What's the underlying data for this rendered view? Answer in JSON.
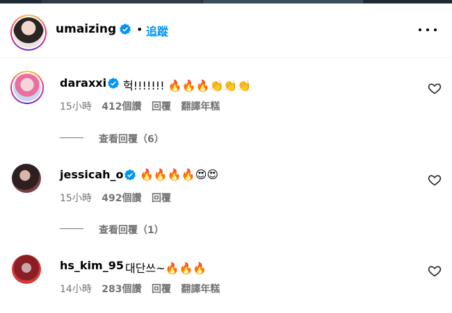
{
  "header": {
    "username": "umaizing",
    "dot": "•",
    "follow_label": "追蹤"
  },
  "comments": [
    {
      "username": "daraxxi",
      "text": "헉!!!!!!! 🔥🔥🔥👏👏👏",
      "time": "15小時",
      "likes": "412個讚",
      "reply_label": "回覆",
      "translate_label": "翻譯年糕",
      "view_replies": "查看回覆（6）"
    },
    {
      "username": "jessicah_o",
      "text": "🔥🔥🔥🔥😍😍",
      "time": "15小時",
      "likes": "492個讚",
      "reply_label": "回覆",
      "view_replies": "查看回覆（1）"
    },
    {
      "username": "hs_kim_95",
      "text": "대단쓰~🔥🔥🔥",
      "time": "14小時",
      "likes": "283個讚",
      "reply_label": "回覆",
      "translate_label": "翻譯年糕"
    }
  ],
  "icons": {
    "verified": "verified-badge-icon",
    "heart": "heart-outline-icon",
    "more": "more-options-icon"
  },
  "colors": {
    "accent": "#0095f6",
    "muted": "#737373"
  }
}
